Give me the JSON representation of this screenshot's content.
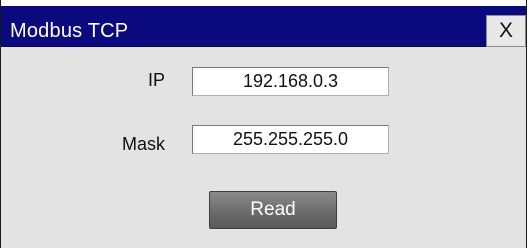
{
  "window": {
    "title": "Modbus TCP",
    "close_label": "X"
  },
  "form": {
    "ip_label": "IP",
    "ip_value": "192.168.0.3",
    "mask_label": "Mask",
    "mask_value": "255.255.255.0",
    "read_label": "Read"
  },
  "colors": {
    "titlebar": "#0a0a7e",
    "dialog_background": "#e3e3e3",
    "button": "#6c6c6c"
  }
}
